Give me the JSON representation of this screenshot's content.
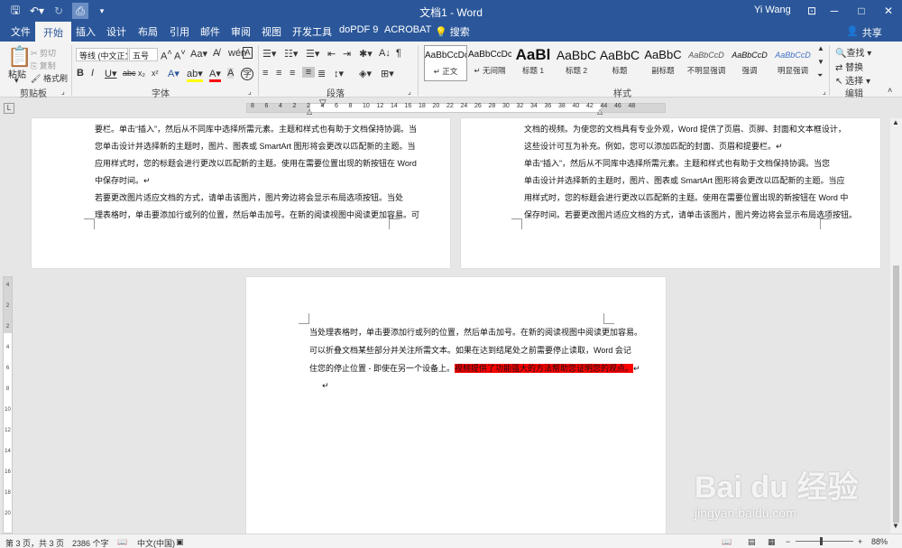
{
  "window": {
    "title": "文档1 - Word",
    "user": "Yi Wang",
    "controls": [
      "─",
      "⧉",
      "□",
      "✕"
    ]
  },
  "tabs": [
    "文件",
    "开始",
    "插入",
    "设计",
    "布局",
    "引用",
    "邮件",
    "审阅",
    "视图",
    "开发工具",
    "doPDF 9",
    "ACROBAT",
    "搜索"
  ],
  "share_label": "共享",
  "ribbon": {
    "clipboard": {
      "paste": "粘贴",
      "cut": "剪切",
      "copy": "复制",
      "format_painter": "格式刷",
      "label": "剪贴板"
    },
    "font": {
      "name": "等线 (中文正文)",
      "size": "五号",
      "label": "字体"
    },
    "paragraph": {
      "label": "段落"
    },
    "styles": {
      "label": "样式",
      "items": [
        {
          "preview": "AaBbCcDc",
          "name": "↵ 正文"
        },
        {
          "preview": "AaBbCcDc",
          "name": "↵ 无间隔"
        },
        {
          "preview": "AaBl",
          "name": "标题 1"
        },
        {
          "preview": "AaBbC",
          "name": "标题 2"
        },
        {
          "preview": "AaBbC",
          "name": "标题"
        },
        {
          "preview": "AaBbC",
          "name": "副标题"
        },
        {
          "preview": "AaBbCcD",
          "name": "不明显强调"
        },
        {
          "preview": "AaBbCcD",
          "name": "强调"
        },
        {
          "preview": "AaBbCcD",
          "name": "明显强调"
        }
      ]
    },
    "editing": {
      "find": "查找",
      "replace": "替换",
      "select": "选择",
      "label": "编辑"
    }
  },
  "ruler": {
    "numbers": [
      "8",
      "6",
      "4",
      "2",
      "2",
      "4",
      "6",
      "8",
      "10",
      "12",
      "14",
      "16",
      "18",
      "20",
      "22",
      "24",
      "26",
      "28",
      "30",
      "32",
      "34",
      "36",
      "38",
      "40",
      "42",
      "44",
      "46",
      "48"
    ],
    "vnumbers": [
      "4",
      "2",
      "2",
      "4",
      "6",
      "8",
      "10",
      "12",
      "14",
      "16",
      "18",
      "20"
    ]
  },
  "page1_lines": [
    "要栏。单击“插入”，然后从不同库中选择所需元素。主题和样式也有助于文档保持协调。当",
    "您单击设计并选择新的主题时，图片、图表或 SmartArt 图形将会更改以匹配新的主题。当",
    "应用样式时，您的标题会进行更改以匹配新的主题。使用在需要位置出现的新按钮在 Word",
    "中保存时间。↵",
    "    若要更改图片适应文档的方式，请单击该图片，图片旁边将会显示布局选项按钮。当处",
    "理表格时，单击要添加行或列的位置，然后单击加号。在新的阅读视图中阅读更加容易。可"
  ],
  "page2_lines": [
    "文档的视频。为使您的文档具有专业外观，Word 提供了页眉、页脚、封面和文本框设计，",
    "这些设计可互为补充。例如，您可以添加匹配的封面、页眉和提要栏。↵",
    "    单击“插入”，然后从不同库中选择所需元素。主题和样式也有助于文档保持协调。当您",
    "单击设计并选择新的主题时，图片、图表或 SmartArt 图形将会更改以匹配新的主题。当应",
    "用样式时，您的标题会进行更改以匹配新的主题。使用在需要位置出现的新按钮在 Word 中",
    "保存时间。若要更改图片适应文档的方式，请单击该图片，图片旁边将会显示布局选项按钮。"
  ],
  "page3_lines": [
    "当处理表格时，单击要添加行或列的位置，然后单击加号。在新的阅读视图中阅读更加容易。",
    "可以折叠文档某些部分并关注所需文本。如果在达到结尾处之前需要停止读取，Word 会记",
    "住您的停止位置 - 即使在另一个设备上。"
  ],
  "page3_highlight": "视频提供了功能强大的方法帮助您证明您的观点。",
  "status": {
    "page": "第 3 页，共 3 页",
    "words": "2386 个字",
    "lang": "中文(中国)",
    "zoom": "88%",
    "zoom_level_percent": 88
  },
  "watermark": {
    "logo": "Bai du 经验",
    "url": "jingyan.baidu.com"
  }
}
